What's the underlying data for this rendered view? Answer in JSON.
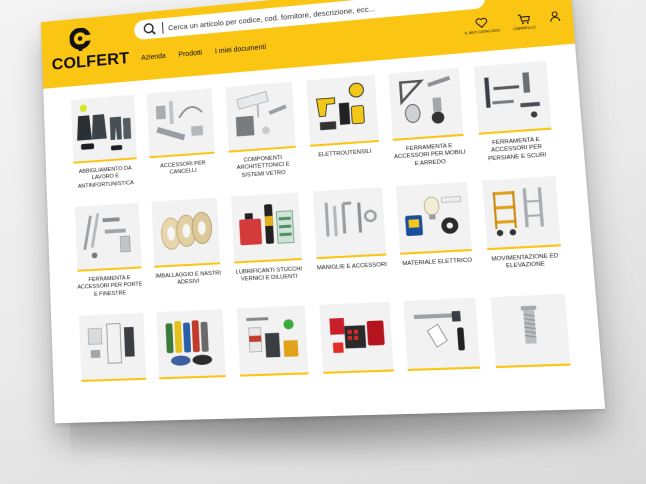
{
  "brand": {
    "name": "COLFERT",
    "color": "#fbc514"
  },
  "search": {
    "placeholder": "Cerca un articolo per codice, cod. fornitore, descrizione, ecc..."
  },
  "nav": [
    "Azienda",
    "Prodotti",
    "I miei documenti"
  ],
  "actions": [
    {
      "icon": "heart-icon",
      "label": "IL MIO CATALOGO"
    },
    {
      "icon": "cart-icon",
      "label": "CARRELLO"
    },
    {
      "icon": "user-icon",
      "label": ""
    }
  ],
  "categories": [
    {
      "label": "ABBIGLIAMENTO DA LAVORO E ANTINFORTUNISTICA",
      "icon": "workwear-icon"
    },
    {
      "label": "ACCESSORI PER CANCELLI",
      "icon": "gate-accessories-icon"
    },
    {
      "label": "COMPONENTI ARCHITETTONICI E SISTEMI VETRO",
      "icon": "architectural-components-icon"
    },
    {
      "label": "ELETTROUTENSILI",
      "icon": "power-tools-icon"
    },
    {
      "label": "FERRAMENTA E ACCESSORI PER MOBILI E ARREDO",
      "icon": "furniture-hardware-icon"
    },
    {
      "label": "FERRAMENTA E ACCESSORI PER PERSIANE E SCURI",
      "icon": "shutter-hardware-icon"
    },
    {
      "label": "FERRAMENTA E ACCESSORI PER PORTE E FINESTRE",
      "icon": "door-window-hardware-icon"
    },
    {
      "label": "IMBALLAGGIO E NASTRI ADESIVI",
      "icon": "tape-icon"
    },
    {
      "label": "LUBRIFICANTI STUCCHI VERNICI E DILUENTI",
      "icon": "lubricants-icon"
    },
    {
      "label": "MANIGLIE E ACCESSORI",
      "icon": "handles-icon"
    },
    {
      "label": "MATERIALE ELETTRICO",
      "icon": "electrical-material-icon"
    },
    {
      "label": "MOVIMENTAZIONE ED ELEVAZIONE",
      "icon": "lifting-icon"
    },
    {
      "label": "",
      "icon": "door-closer-icon"
    },
    {
      "label": "",
      "icon": "sealants-icon"
    },
    {
      "label": "",
      "icon": "cleaning-products-icon"
    },
    {
      "label": "",
      "icon": "tool-cases-icon"
    },
    {
      "label": "",
      "icon": "safety-lock-icon"
    },
    {
      "label": "",
      "icon": "threaded-insert-icon"
    }
  ]
}
